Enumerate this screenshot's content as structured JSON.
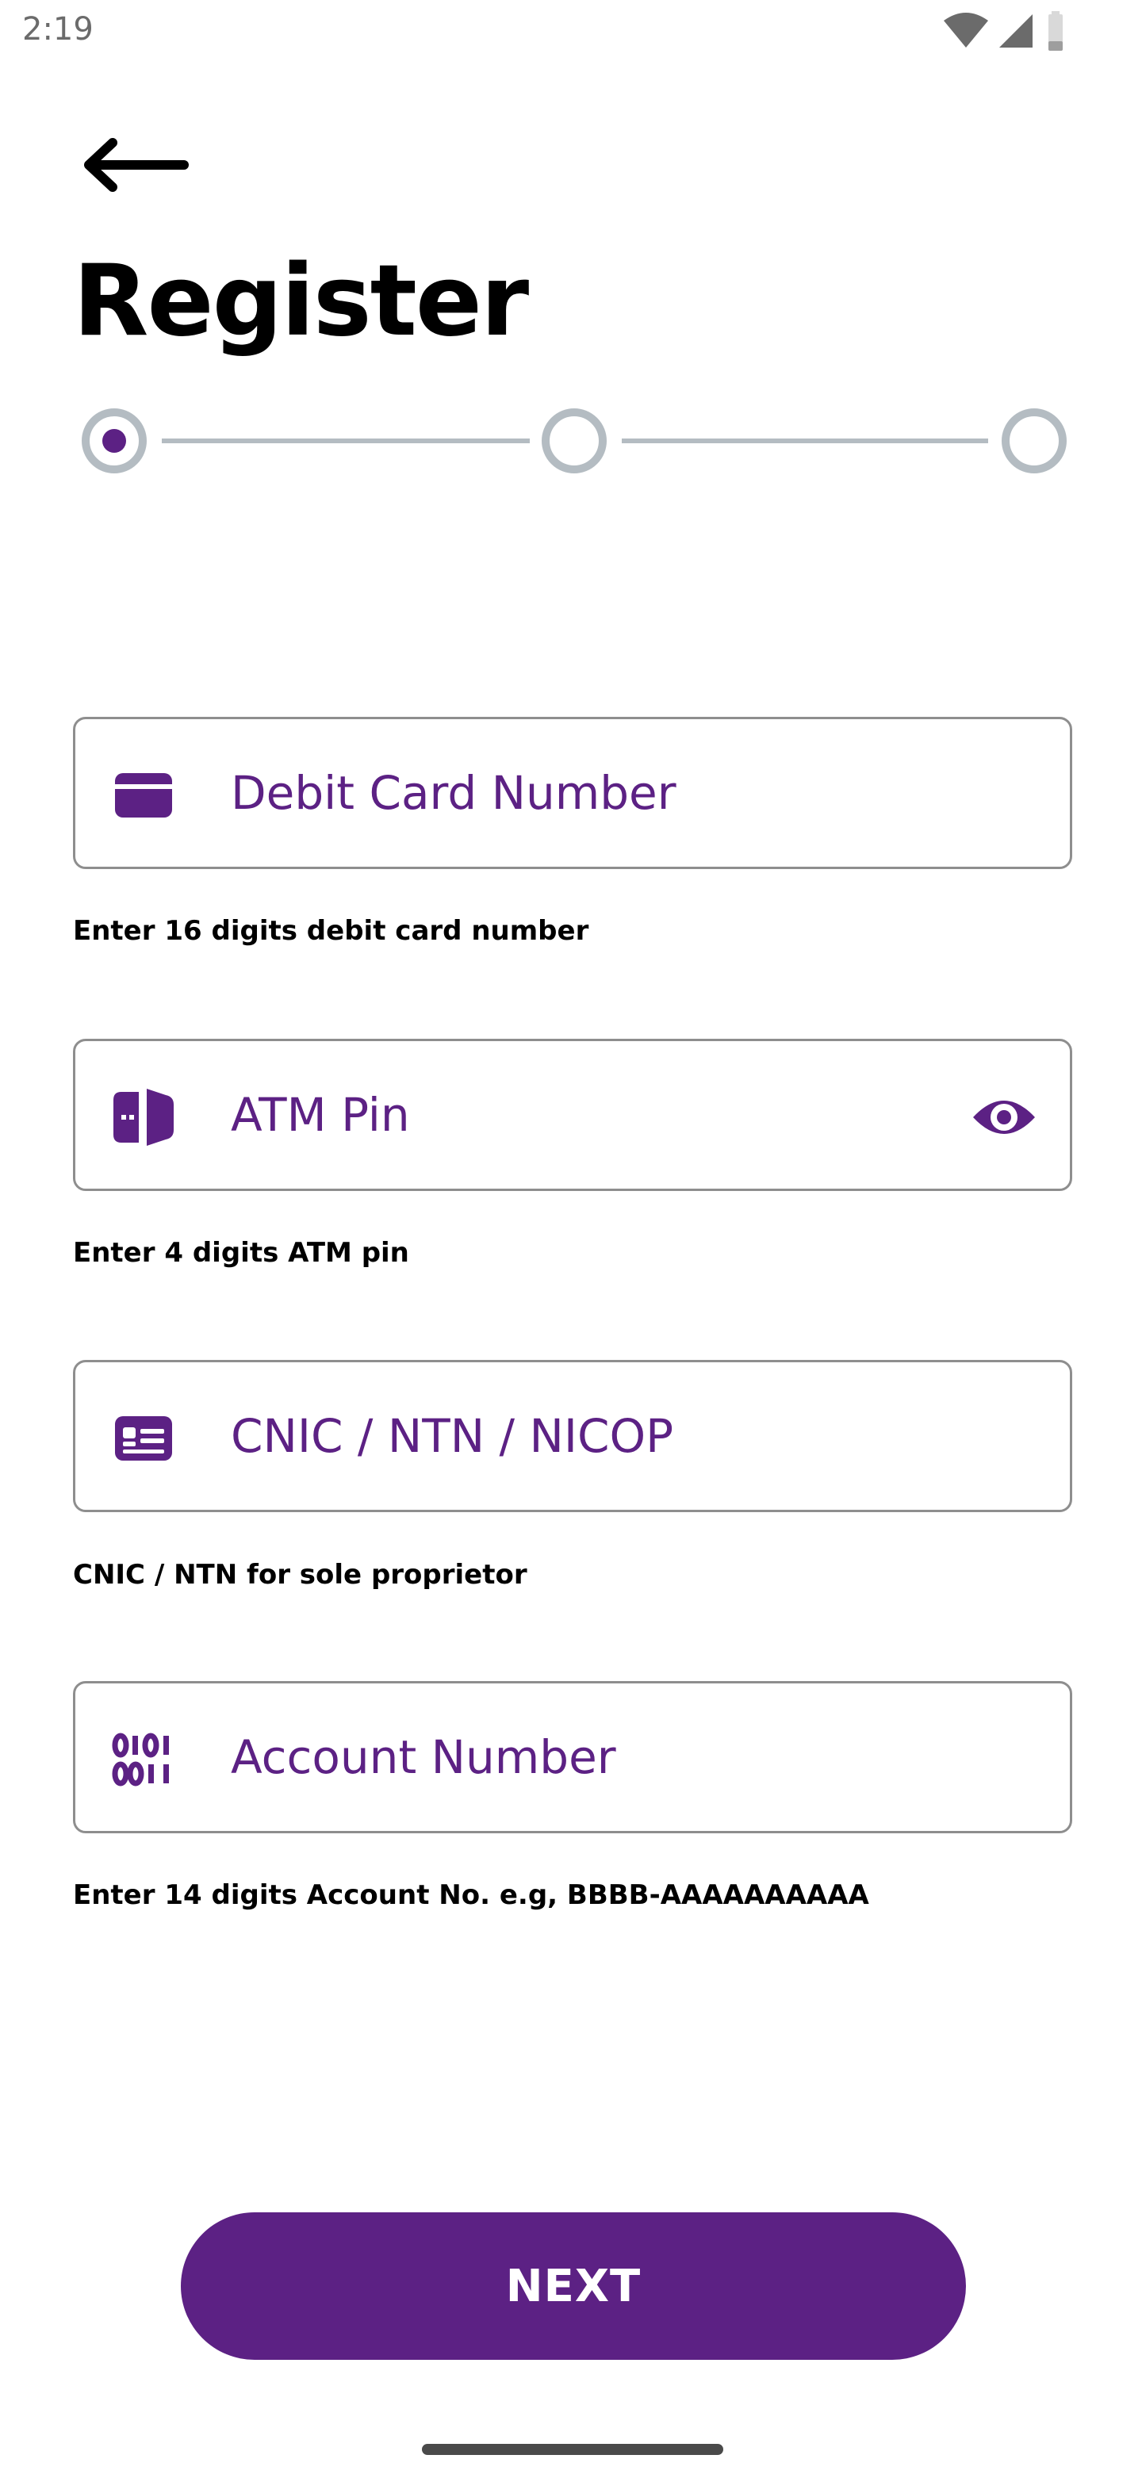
{
  "status_bar": {
    "time": "2:19"
  },
  "header": {
    "title": "Register"
  },
  "stepper": {
    "total_steps": 3,
    "current_step": 1
  },
  "fields": [
    {
      "icon": "card-icon",
      "placeholder": "Debit Card Number",
      "value": "",
      "helper": "Enter 16 digits debit card number"
    },
    {
      "icon": "atm-pin-icon",
      "placeholder": "ATM Pin",
      "value": "",
      "helper": "Enter 4 digits ATM pin",
      "trailing_icon": "eye-icon"
    },
    {
      "icon": "id-card-icon",
      "placeholder": "CNIC / NTN / NICOP",
      "value": "",
      "helper": "CNIC / NTN for sole proprietor"
    },
    {
      "icon": "binary-icon",
      "placeholder": "Account Number",
      "value": "",
      "helper": "Enter 14 digits Account No. e.g, BBBB-AAAAAAAAAA"
    }
  ],
  "actions": {
    "next_label": "NEXT"
  },
  "colors": {
    "brand": "#5c2184",
    "step_inactive": "#b4bcc2",
    "border": "#8e8e8e"
  }
}
